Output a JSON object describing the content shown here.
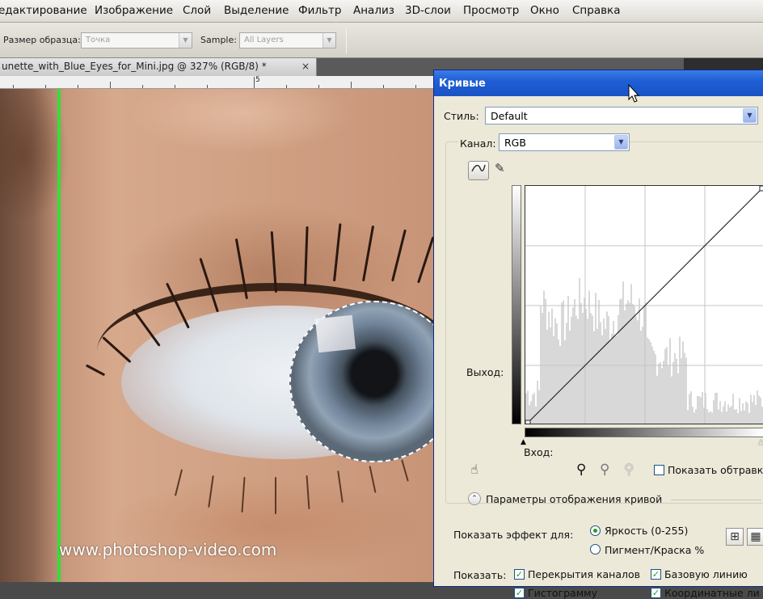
{
  "menubar": {
    "items": [
      "едактирование",
      "Изображение",
      "Слой",
      "Выделение",
      "Фильтр",
      "Анализ",
      "3D-слои",
      "Просмотр",
      "Окно",
      "Справка"
    ]
  },
  "options_bar": {
    "sample_size_label": "Размер образца:",
    "sample_size_value": "Точка",
    "sample_label": "Sample:",
    "sample_value": "All Layers"
  },
  "document": {
    "tab_title": "unette_with_Blue_Eyes_for_Mini.jpg @ 327% (RGB/8) *",
    "close_glyph": "×",
    "ruler_number": "5",
    "watermark": "www.photoshop-video.com"
  },
  "curves_dialog": {
    "title": "Кривые",
    "style_label": "Стиль:",
    "style_value": "Default",
    "channel_label": "Канал:",
    "channel_value": "RGB",
    "output_label": "Выход:",
    "input_label": "Вход:",
    "show_clipping_label": "Показать обтравку",
    "show_clipping_checked": false,
    "display_options_label": "Параметры отображения кривой",
    "show_effect_label": "Показать эффект для:",
    "brightness_label": "Яркость (0-255)",
    "brightness_selected": true,
    "pigment_label": "Пигмент/Краска %",
    "pigment_selected": false,
    "show_label": "Показать:",
    "overlays_label": "Перекрытия каналов",
    "overlays_checked": true,
    "baseline_label": "Базовую линию",
    "baseline_checked": true,
    "histogram_label": "Гистограмму",
    "histogram_checked": true,
    "intersection_label": "Координатные ли",
    "intersection_checked": true,
    "curve_points": [
      [
        0,
        0
      ],
      [
        255,
        255
      ]
    ]
  },
  "colors": {
    "guide_line": "#33e03a",
    "title_bar": "#1f5fd6",
    "check": "#21a121"
  }
}
